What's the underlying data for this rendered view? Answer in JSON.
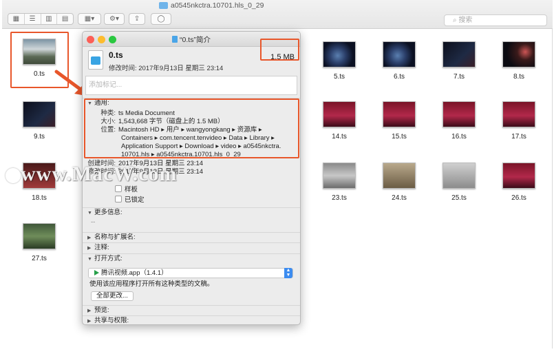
{
  "window": {
    "title": "a0545nkctra.10701.hls_0_29"
  },
  "toolbar": {
    "search_placeholder": "搜索"
  },
  "files": [
    {
      "name": "0.ts"
    },
    {
      "name": "5.ts"
    },
    {
      "name": "6.ts"
    },
    {
      "name": "7.ts"
    },
    {
      "name": "8.ts"
    },
    {
      "name": "9.ts"
    },
    {
      "name": "14.ts"
    },
    {
      "name": "15.ts"
    },
    {
      "name": "16.ts"
    },
    {
      "name": "17.ts"
    },
    {
      "name": "18.ts"
    },
    {
      "name": "23.ts"
    },
    {
      "name": "24.ts"
    },
    {
      "name": "25.ts"
    },
    {
      "name": "26.ts"
    },
    {
      "name": "27.ts"
    }
  ],
  "info": {
    "title": "“0.ts”简介",
    "filename": "0.ts",
    "modified": "修改时间: 2017年9月13日 星期三 23:14",
    "size": "1.5 MB",
    "tags_placeholder": "添加标记...",
    "general": {
      "header": "通用:",
      "kind_label": "种类:",
      "kind": "ts Media Document",
      "size_label": "大小:",
      "size": "1,543,668 字节（磁盘上的 1.5 MB）",
      "where_label": "位置:",
      "where": [
        "Macintosh HD ▸ 用户 ▸ wangyongkang ▸ 资源库 ▸",
        "Containers ▸ com.tencent.tenvideo ▸ Data ▸ Library ▸",
        "Application Support ▸ Download ▸ video ▸ a0545nkctra.",
        "10701.hls ▸ a0545nkctra.10701.hls_0_29"
      ],
      "created_label": "创建时间:",
      "created": "2017年9月13日 星期三 23:14",
      "modified_label": "修改时间:",
      "modified": "2017年9月13日 星期三 23:14",
      "stationery": "样板",
      "locked": "已锁定"
    },
    "more_info": {
      "header": "更多信息:",
      "value": "--"
    },
    "name_ext": {
      "header": "名称与扩展名:"
    },
    "comments": {
      "header": "注释:"
    },
    "open_with": {
      "header": "打开方式:",
      "app": "腾讯视频.app（1.4.1）",
      "hint": "使用该应用程序打开所有这种类型的文稿。",
      "change_all": "全部更改..."
    },
    "preview": {
      "header": "预览:"
    },
    "sharing": {
      "header": "共享与权限:"
    }
  },
  "watermark": "www.MacW.com",
  "colors": {
    "highlight": "#e8562a",
    "accent": "#3c8cf0"
  }
}
